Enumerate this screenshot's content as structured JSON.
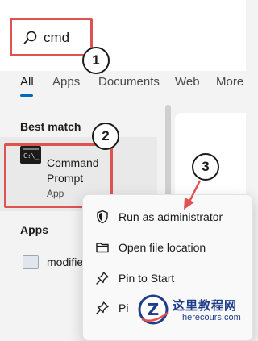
{
  "search": {
    "query": "cmd",
    "icon": "search-icon"
  },
  "tabs": [
    {
      "label": "All",
      "active": true
    },
    {
      "label": "Apps",
      "active": false
    },
    {
      "label": "Documents",
      "active": false
    },
    {
      "label": "Web",
      "active": false
    },
    {
      "label": "More",
      "active": false
    }
  ],
  "best_match": {
    "section_label": "Best match",
    "name": "Command Prompt",
    "type": "App",
    "icon": "command-prompt-icon"
  },
  "apps_section": {
    "section_label": "Apps",
    "items": [
      {
        "label": "modifie",
        "icon": "app-icon"
      }
    ]
  },
  "context_menu": {
    "items": [
      {
        "label": "Run as administrator",
        "icon": "shield-icon"
      },
      {
        "label": "Open file location",
        "icon": "folder-icon"
      },
      {
        "label": "Pin to Start",
        "icon": "pin-icon"
      },
      {
        "label": "Pi",
        "icon": "pin-icon"
      }
    ]
  },
  "callouts": {
    "one": "1",
    "two": "2",
    "three": "3"
  },
  "watermark": {
    "line1": "这里教程网",
    "line2": "herecours.com"
  },
  "colors": {
    "highlight": "#e05252",
    "accent": "#0067c0",
    "watermark": "#1f3d8a"
  }
}
